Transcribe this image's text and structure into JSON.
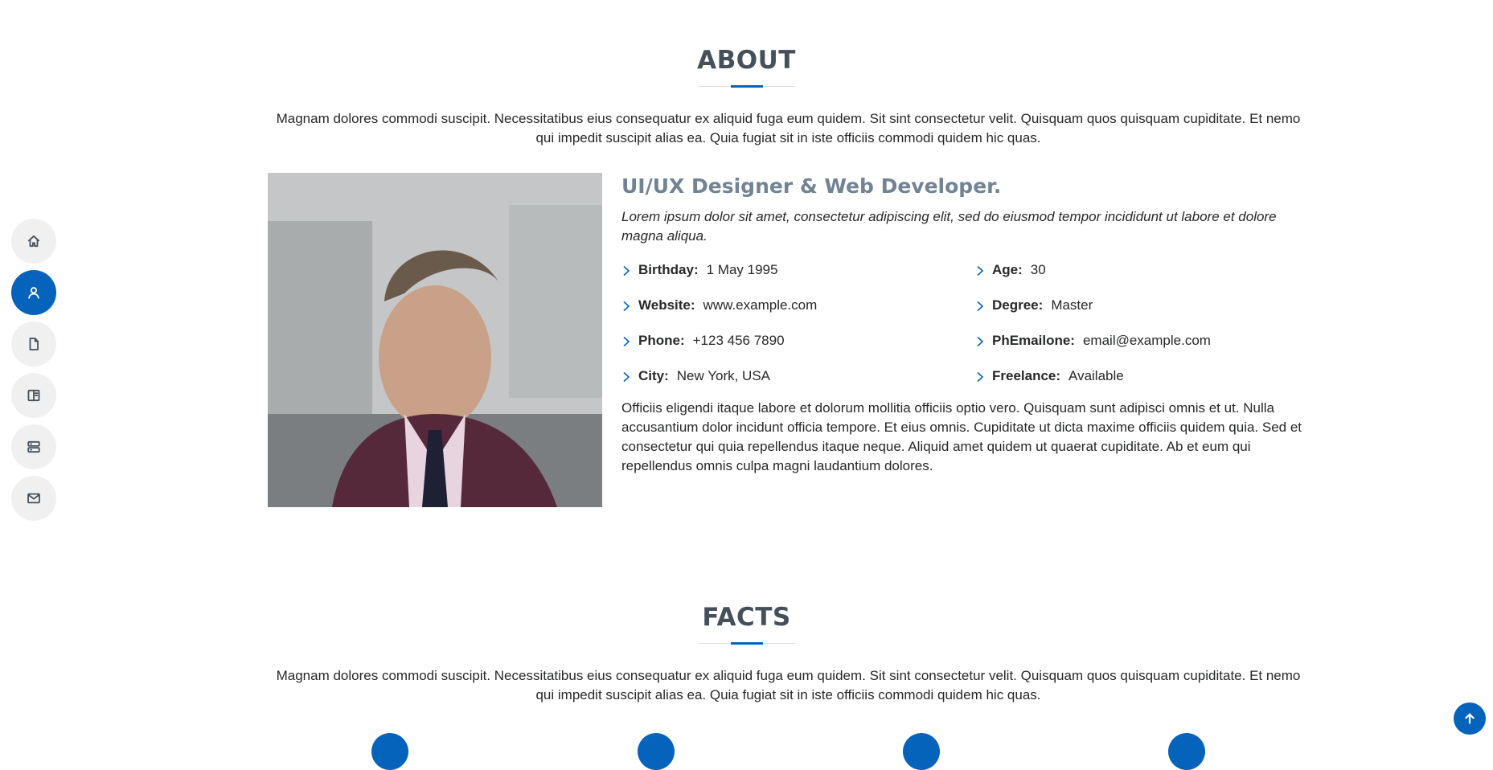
{
  "nav": {
    "items": [
      {
        "icon": "house-icon"
      },
      {
        "icon": "person-icon"
      },
      {
        "icon": "file-icon"
      },
      {
        "icon": "book-icon"
      },
      {
        "icon": "server-icon"
      },
      {
        "icon": "envelope-icon"
      }
    ],
    "active_index": 1
  },
  "about": {
    "title": "ABOUT",
    "description": "Magnam dolores commodi suscipit. Necessitatibus eius consequatur ex aliquid fuga eum quidem. Sit sint consectetur velit. Quisquam quos quisquam cupiditate. Et nemo qui impedit suscipit alias ea. Quia fugiat sit in iste officiis commodi quidem hic quas.",
    "heading": "UI/UX Designer & Web Developer.",
    "lead": "Lorem ipsum dolor sit amet, consectetur adipiscing elit, sed do eiusmod tempor incididunt ut labore et dolore magna aliqua.",
    "info": {
      "birthday": {
        "label": "Birthday:",
        "value": "1 May 1995"
      },
      "age": {
        "label": "Age:",
        "value": "30"
      },
      "website": {
        "label": "Website:",
        "value": "www.example.com"
      },
      "degree": {
        "label": "Degree:",
        "value": "Master"
      },
      "phone": {
        "label": "Phone:",
        "value": "+123 456 7890"
      },
      "email": {
        "label": "PhEmailone:",
        "value": "email@example.com"
      },
      "city": {
        "label": "City:",
        "value": "New York, USA"
      },
      "freelance": {
        "label": "Freelance:",
        "value": "Available"
      }
    },
    "bio": "Officiis eligendi itaque labore et dolorum mollitia officiis optio vero. Quisquam sunt adipisci omnis et ut. Nulla accusantium dolor incidunt officia tempore. Et eius omnis. Cupiditate ut dicta maxime officiis quidem quia. Sed et consectetur qui quia repellendus itaque neque. Aliquid amet quidem ut quaerat cupiditate. Ab et eum qui repellendus omnis culpa magni laudantium dolores."
  },
  "facts": {
    "title": "FACTS",
    "description": "Magnam dolores commodi suscipit. Necessitatibus eius consequatur ex aliquid fuga eum quidem. Sit sint consectetur velit. Quisquam quos quisquam cupiditate. Et nemo qui impedit suscipit alias ea. Quia fugiat sit in iste officiis commodi quidem hic quas."
  },
  "colors": {
    "accent": "#0563bb",
    "heading": "#45505b",
    "subheading": "#728394",
    "nav_bg": "#f0f0f0"
  },
  "back_to_top": {
    "icon": "arrow-up-icon"
  }
}
